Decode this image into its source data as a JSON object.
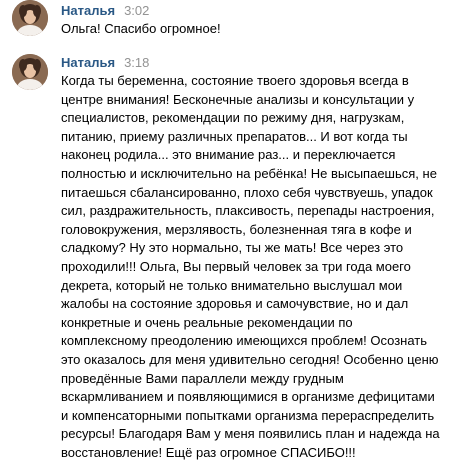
{
  "messages": [
    {
      "author": "Наталья",
      "time": "3:02",
      "lines": [
        "Ольга! Спасибо огромное!"
      ]
    },
    {
      "author": "Наталья",
      "time": "3:18",
      "lines": [
        "Когда ты беременна, состояние твоего здоровья всегда в",
        "центре внимания! Бесконечные анализы и консультации у",
        "специалистов, рекомендации по режиму дня, нагрузкам,",
        "питанию, приему различных препаратов... И вот когда ты",
        "наконец родила... это внимание раз... и переключается",
        "полностью и исключительно на ребёнка! Не высыпаешься, не",
        "питаешься сбалансированно, плохо себя чувствуешь, упадок",
        "сил, раздражительность, плаксивость, перепады настроения,",
        "головокружения, мерзлявость, болезненная тяга в кофе и",
        "сладкому? Ну это нормально, ты же мать! Все через это",
        "проходили!!! Ольга, Вы первый человек за три года моего",
        "декрета, который не только внимательно выслушал мои",
        "жалобы на состояние здоровья и самочувствие, но и дал",
        "конкретные и очень реальные рекомендации по",
        "комплексному преодолению имеющихся проблем! Осознать",
        "это оказалось для меня удивительно сегодня! Особенно ценю",
        "проведённые Вами параллели между грудным",
        "вскармливанием и появляющимися в организме дефицитами",
        "и компенсаторными попытками организма перераспределить",
        "ресурсы! Благодаря Вам у меня появились план и надежда на",
        "восстановление! Ещё раз огромное СПАСИБО!!!"
      ]
    }
  ],
  "icons": {
    "avatar": "avatar-photo-icon"
  },
  "colors": {
    "author": "#2a5885",
    "time": "#939393",
    "text": "#000000",
    "background": "#ffffff"
  }
}
